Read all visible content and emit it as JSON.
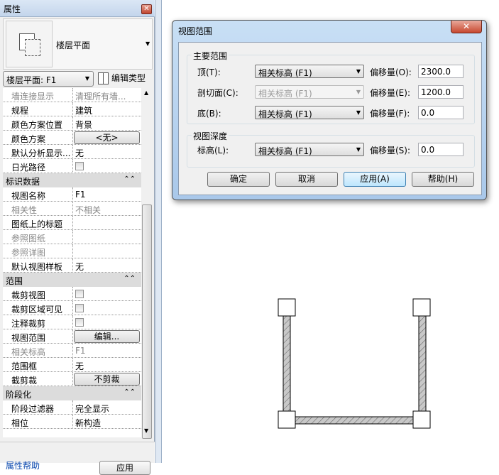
{
  "properties_panel": {
    "title": "属性",
    "close_glyph": "✕",
    "type_name": "楼层平面",
    "instance_selector": "楼层平面: F1",
    "edit_type_label": "编辑类型",
    "rows": [
      {
        "label": "墙连接显示",
        "value": "清理所有墙...",
        "dim": true
      },
      {
        "label": "规程",
        "value": "建筑"
      },
      {
        "label": "颜色方案位置",
        "value": "背景"
      },
      {
        "label": "颜色方案",
        "button": "<无>"
      },
      {
        "label": "默认分析显示...",
        "value": "无"
      },
      {
        "label": "日光路径",
        "checkbox": false
      },
      {
        "header": "标识数据"
      },
      {
        "label": "视图名称",
        "value": "F1"
      },
      {
        "label": "相关性",
        "value": "不相关",
        "dim": true
      },
      {
        "label": "图纸上的标题",
        "value": ""
      },
      {
        "label": "参照图纸",
        "value": "",
        "dim": true
      },
      {
        "label": "参照详图",
        "value": "",
        "dim": true
      },
      {
        "label": "默认视图样板",
        "value": "无"
      },
      {
        "header": "范围"
      },
      {
        "label": "裁剪视图",
        "checkbox": false
      },
      {
        "label": "裁剪区域可见",
        "checkbox": false
      },
      {
        "label": "注释裁剪",
        "checkbox": false
      },
      {
        "label": "视图范围",
        "button": "编辑..."
      },
      {
        "label": "相关标高",
        "value": "F1",
        "dim": true
      },
      {
        "label": "范围框",
        "value": "无"
      },
      {
        "label": "截剪裁",
        "button": "不剪裁"
      },
      {
        "header": "阶段化"
      },
      {
        "label": "阶段过滤器",
        "value": "完全显示"
      },
      {
        "label": "相位",
        "value": "新构造"
      }
    ],
    "help_link": "属性帮助",
    "apply_button": "应用"
  },
  "dialog": {
    "title": "视图范围",
    "close_glyph": "✕",
    "primary_range": {
      "title": "主要范围",
      "rows": [
        {
          "label": "顶(T):",
          "level": "相关标高 (F1)",
          "offset_label": "偏移量(O):",
          "offset": "2300.0",
          "disabled": false
        },
        {
          "label": "剖切面(C):",
          "level": "相关标高 (F1)",
          "offset_label": "偏移量(E):",
          "offset": "1200.0",
          "disabled": true
        },
        {
          "label": "底(B):",
          "level": "相关标高 (F1)",
          "offset_label": "偏移量(F):",
          "offset": "0.0",
          "disabled": false
        }
      ]
    },
    "view_depth": {
      "title": "视图深度",
      "label": "标高(L):",
      "level": "相关标高 (F1)",
      "offset_label": "偏移量(S):",
      "offset": "0.0"
    },
    "buttons": {
      "ok": "确定",
      "cancel": "取消",
      "apply": "应用(A)",
      "help": "帮助(H)"
    }
  }
}
